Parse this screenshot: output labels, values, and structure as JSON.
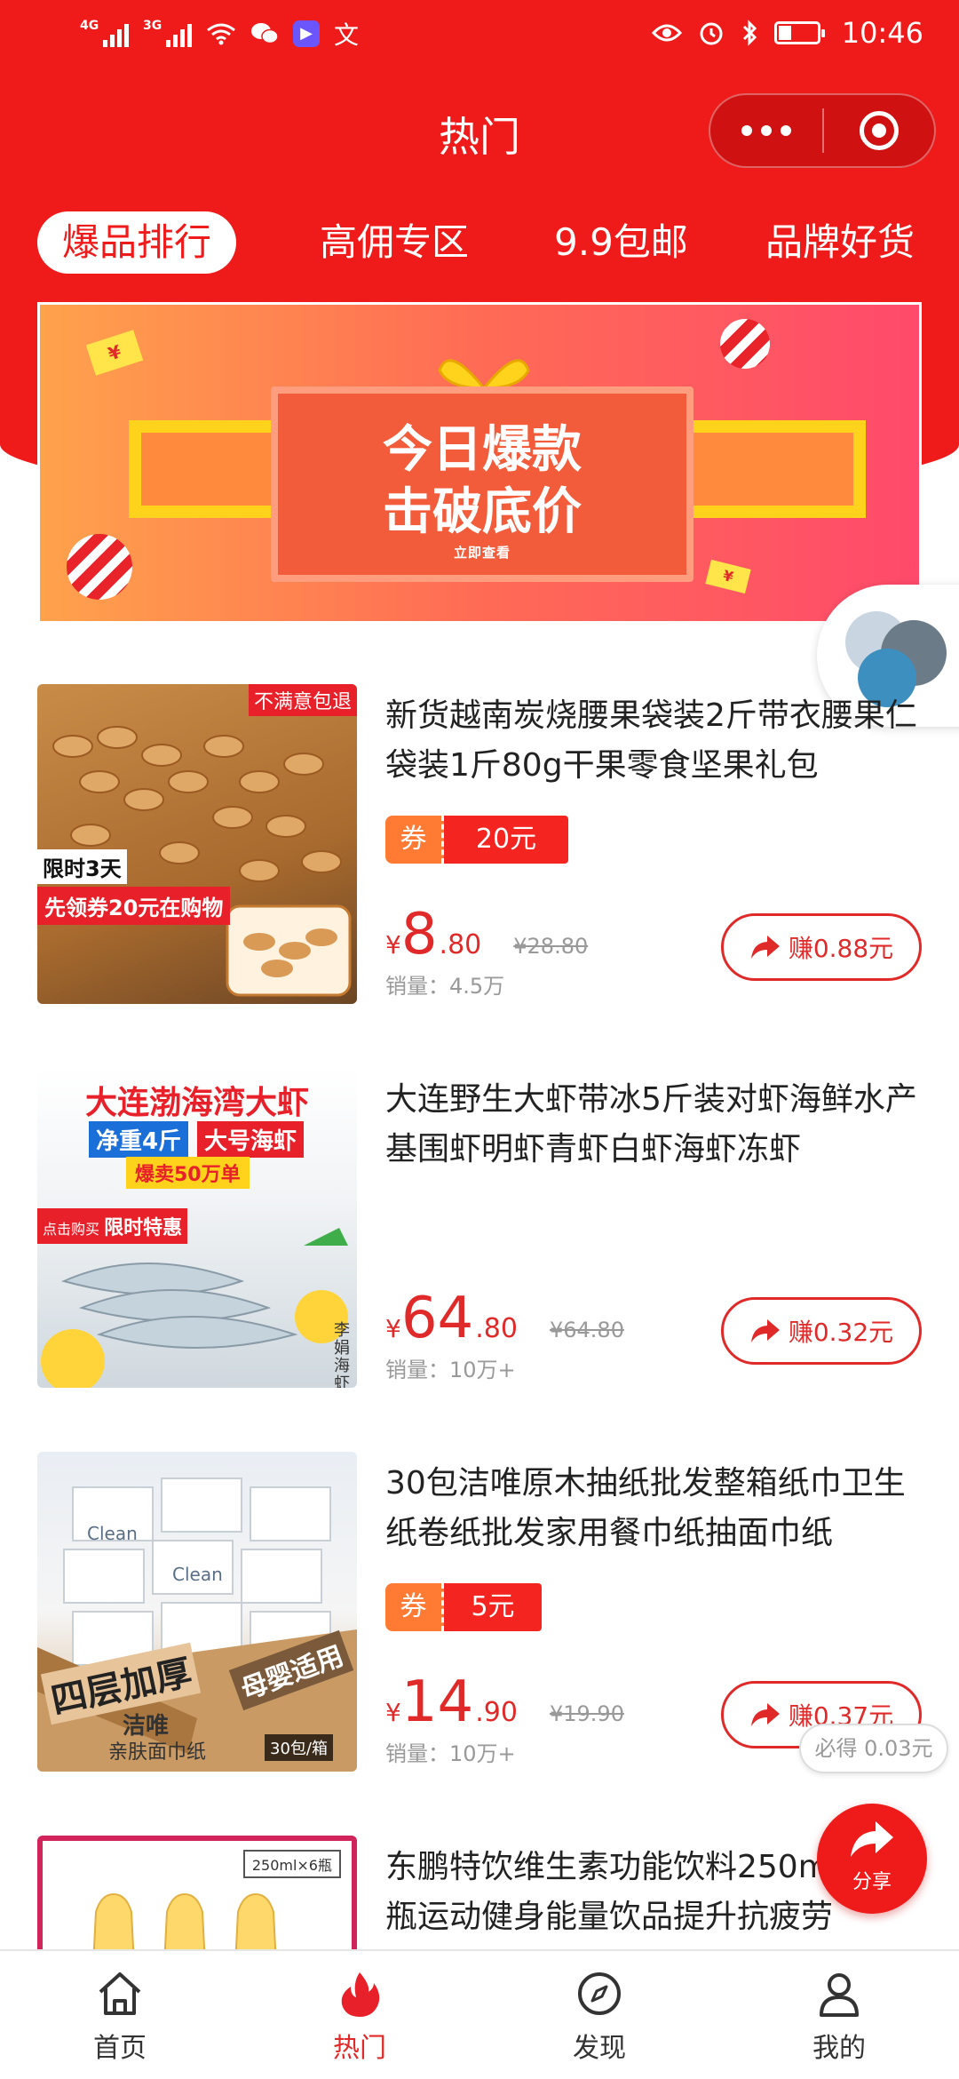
{
  "status": {
    "net1": "4G",
    "net2": "3G",
    "time": "10:46",
    "app_glyph": "文"
  },
  "header": {
    "title": "热门"
  },
  "tabs": [
    {
      "label": "爆品排行",
      "active": true
    },
    {
      "label": "高佣专区",
      "active": false
    },
    {
      "label": "9.9包邮",
      "active": false
    },
    {
      "label": "品牌好货",
      "active": false
    }
  ],
  "banner": {
    "line1": "今日爆款",
    "line2": "击破底价",
    "cta": "立即查看",
    "tag": "¥"
  },
  "products": [
    {
      "title": "新货越南炭烧腰果袋装2斤带衣腰果仁袋装1斤80g干果零食坚果礼包",
      "coupon_label": "券",
      "coupon_value": "20元",
      "yen": "¥",
      "price_int": "8",
      "price_dec": ".80",
      "orig_price": "¥28.80",
      "sales": "销量：4.5万",
      "earn": "赚0.88元",
      "img_text": {
        "corner": "不满意包退",
        "badge1": "限时3天",
        "badge2": "先领券20元在购物"
      }
    },
    {
      "title": "大连野生大虾带冰5斤装对虾海鲜水产基围虾明虾青虾白虾海虾冻虾",
      "yen": "¥",
      "price_int": "64",
      "price_dec": ".80",
      "orig_price": "¥64.80",
      "sales": "销量：10万+",
      "earn": "赚0.32元",
      "img_text": {
        "headline": "大连渤海湾大虾",
        "tag1": "净重4斤",
        "tag2": "大号海虾",
        "tag3": "爆卖50万单",
        "tag4": "点击购买",
        "tag5": "限时特惠",
        "side": "李娟海虾"
      }
    },
    {
      "title": "30包洁唯原木抽纸批发整箱纸巾卫生纸卷纸批发家用餐巾纸抽面巾纸",
      "coupon_label": "券",
      "coupon_value": "5元",
      "yen": "¥",
      "price_int": "14",
      "price_dec": ".90",
      "orig_price": "¥19.90",
      "sales": "销量：10万+",
      "earn": "赚0.37元",
      "img_text": {
        "brand": "Clean",
        "banner1": "四层加厚",
        "banner2": "母婴适用",
        "box_brand": "洁唯",
        "box_label": "亲肤面巾纸",
        "count": "30包/箱"
      }
    },
    {
      "title": "东鹏特饮维生素功能饮料250ml×24瓶运动健身能量饮品提升抗疲劳",
      "img_text": {
        "pack": "250ml×6瓶"
      }
    }
  ],
  "floating": {
    "bonus": "必得 0.03元",
    "share": "分享"
  },
  "bottom_nav": [
    {
      "label": "首页",
      "icon": "home-icon",
      "active": false
    },
    {
      "label": "热门",
      "icon": "flame-icon",
      "active": true
    },
    {
      "label": "发现",
      "icon": "compass-icon",
      "active": false
    },
    {
      "label": "我的",
      "icon": "user-icon",
      "active": false
    }
  ],
  "colors": {
    "brand_red": "#ef1b1b",
    "price_red": "#e02a2a",
    "coupon_orange": "#ff7a32"
  }
}
